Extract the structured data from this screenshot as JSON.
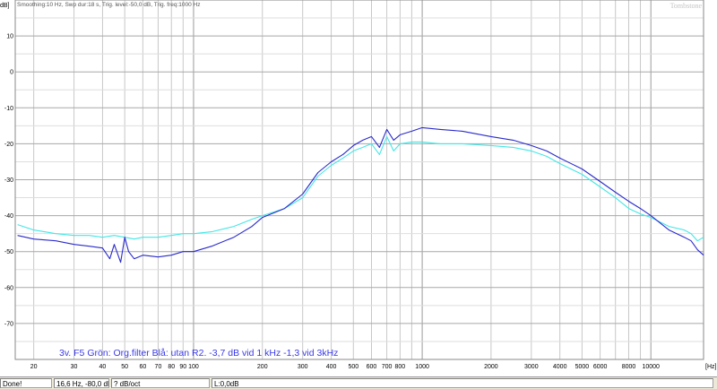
{
  "header": {
    "unit_label": "dB]",
    "info": "Smoothing:10 Hz, Swp dur:18 s, Trig. level:-50,0 dB, Trig. freq:1000 Hz",
    "watermark": "Tombstone"
  },
  "annotation": "3v. F5 Grön: Org.filter Blå: utan R2. -3,7 dB vid 1 kHz -1,3 vid 3kHz",
  "status": {
    "state": "Done!",
    "cursor": "16,6 Hz, -80,0 dB",
    "slope": "? dB/oct",
    "level": "L:0,0dB"
  },
  "colors": {
    "background": "#ffffff",
    "grid": "#c8c8c8",
    "axis_text": "#000000",
    "annotation": "#3a3ae8",
    "series_blue": "#2a2acc",
    "series_cyan": "#44e6e6"
  },
  "chart_data": {
    "type": "line",
    "x_scale": "log",
    "xlim": [
      16.6,
      17000
    ],
    "ylim": [
      -80,
      20
    ],
    "x_unit": "[Hz]",
    "y_unit": "dB]",
    "grid": true,
    "x_ticks": [
      20,
      30,
      40,
      50,
      60,
      70,
      80,
      90,
      100,
      200,
      300,
      400,
      500,
      600,
      700,
      800,
      1000,
      2000,
      3000,
      4000,
      5000,
      6000,
      8000,
      10000
    ],
    "x_tick_labels": [
      "20",
      "30",
      "40",
      "50",
      "60",
      "70",
      "80",
      "90",
      "100",
      "200",
      "300",
      "400",
      "500",
      "600",
      "700",
      "800",
      "1000",
      "2000",
      "3000",
      "4000",
      "5000",
      "6000",
      "8000",
      "10000"
    ],
    "y_ticks": [
      10,
      0,
      -10,
      -20,
      -30,
      -40,
      -50,
      -60,
      -70
    ],
    "y_tick_labels": [
      "10",
      "0",
      "-10",
      "-20",
      "-30",
      "-40",
      "-50",
      "-60",
      "-70"
    ],
    "series": [
      {
        "color": "#2a2acc",
        "x": [
          17,
          20,
          25,
          30,
          35,
          40,
          43,
          45,
          48,
          50,
          52,
          55,
          60,
          70,
          80,
          90,
          100,
          120,
          150,
          180,
          200,
          250,
          300,
          350,
          400,
          450,
          500,
          550,
          600,
          650,
          700,
          750,
          800,
          900,
          1000,
          1200,
          1500,
          2000,
          2500,
          3000,
          3500,
          4000,
          5000,
          6000,
          7000,
          8000,
          9000,
          10000,
          12000,
          14000,
          15000,
          16000,
          17000
        ],
        "y": [
          -45.5,
          -46.5,
          -47,
          -48,
          -48.5,
          -49,
          -52,
          -48,
          -53,
          -46,
          -50,
          -52,
          -51,
          -51.5,
          -51,
          -50,
          -50,
          -48.5,
          -46,
          -43,
          -40.5,
          -38,
          -34,
          -28,
          -25,
          -23,
          -20.5,
          -19,
          -18,
          -21,
          -16,
          -19,
          -17.5,
          -16.5,
          -15.5,
          -16,
          -16.5,
          -18,
          -19,
          -20.5,
          -22,
          -24,
          -27,
          -30.5,
          -33.5,
          -36,
          -38,
          -40,
          -44,
          -46,
          -47,
          -49.5,
          -51
        ]
      },
      {
        "color": "#44e6e6",
        "x": [
          17,
          20,
          25,
          30,
          35,
          40,
          45,
          50,
          55,
          60,
          70,
          80,
          90,
          100,
          120,
          150,
          180,
          200,
          250,
          300,
          350,
          400,
          450,
          500,
          550,
          600,
          650,
          700,
          750,
          800,
          900,
          1000,
          1200,
          1500,
          2000,
          2500,
          3000,
          3500,
          4000,
          5000,
          6000,
          7000,
          8000,
          9000,
          10000,
          12000,
          14000,
          15000,
          16000,
          17000
        ],
        "y": [
          -42.5,
          -44,
          -45,
          -45.5,
          -45.5,
          -46,
          -45.5,
          -46,
          -46.5,
          -46,
          -46,
          -45.5,
          -45,
          -45,
          -44.5,
          -43,
          -41,
          -40,
          -38,
          -35,
          -29,
          -26,
          -24,
          -22,
          -21,
          -20,
          -23,
          -18,
          -22,
          -20,
          -19.5,
          -19.5,
          -20,
          -20,
          -20.5,
          -21,
          -22,
          -23.5,
          -25.5,
          -28.5,
          -32,
          -35,
          -38,
          -39.5,
          -40.5,
          -43,
          -44,
          -45,
          -47,
          -46
        ]
      }
    ]
  }
}
